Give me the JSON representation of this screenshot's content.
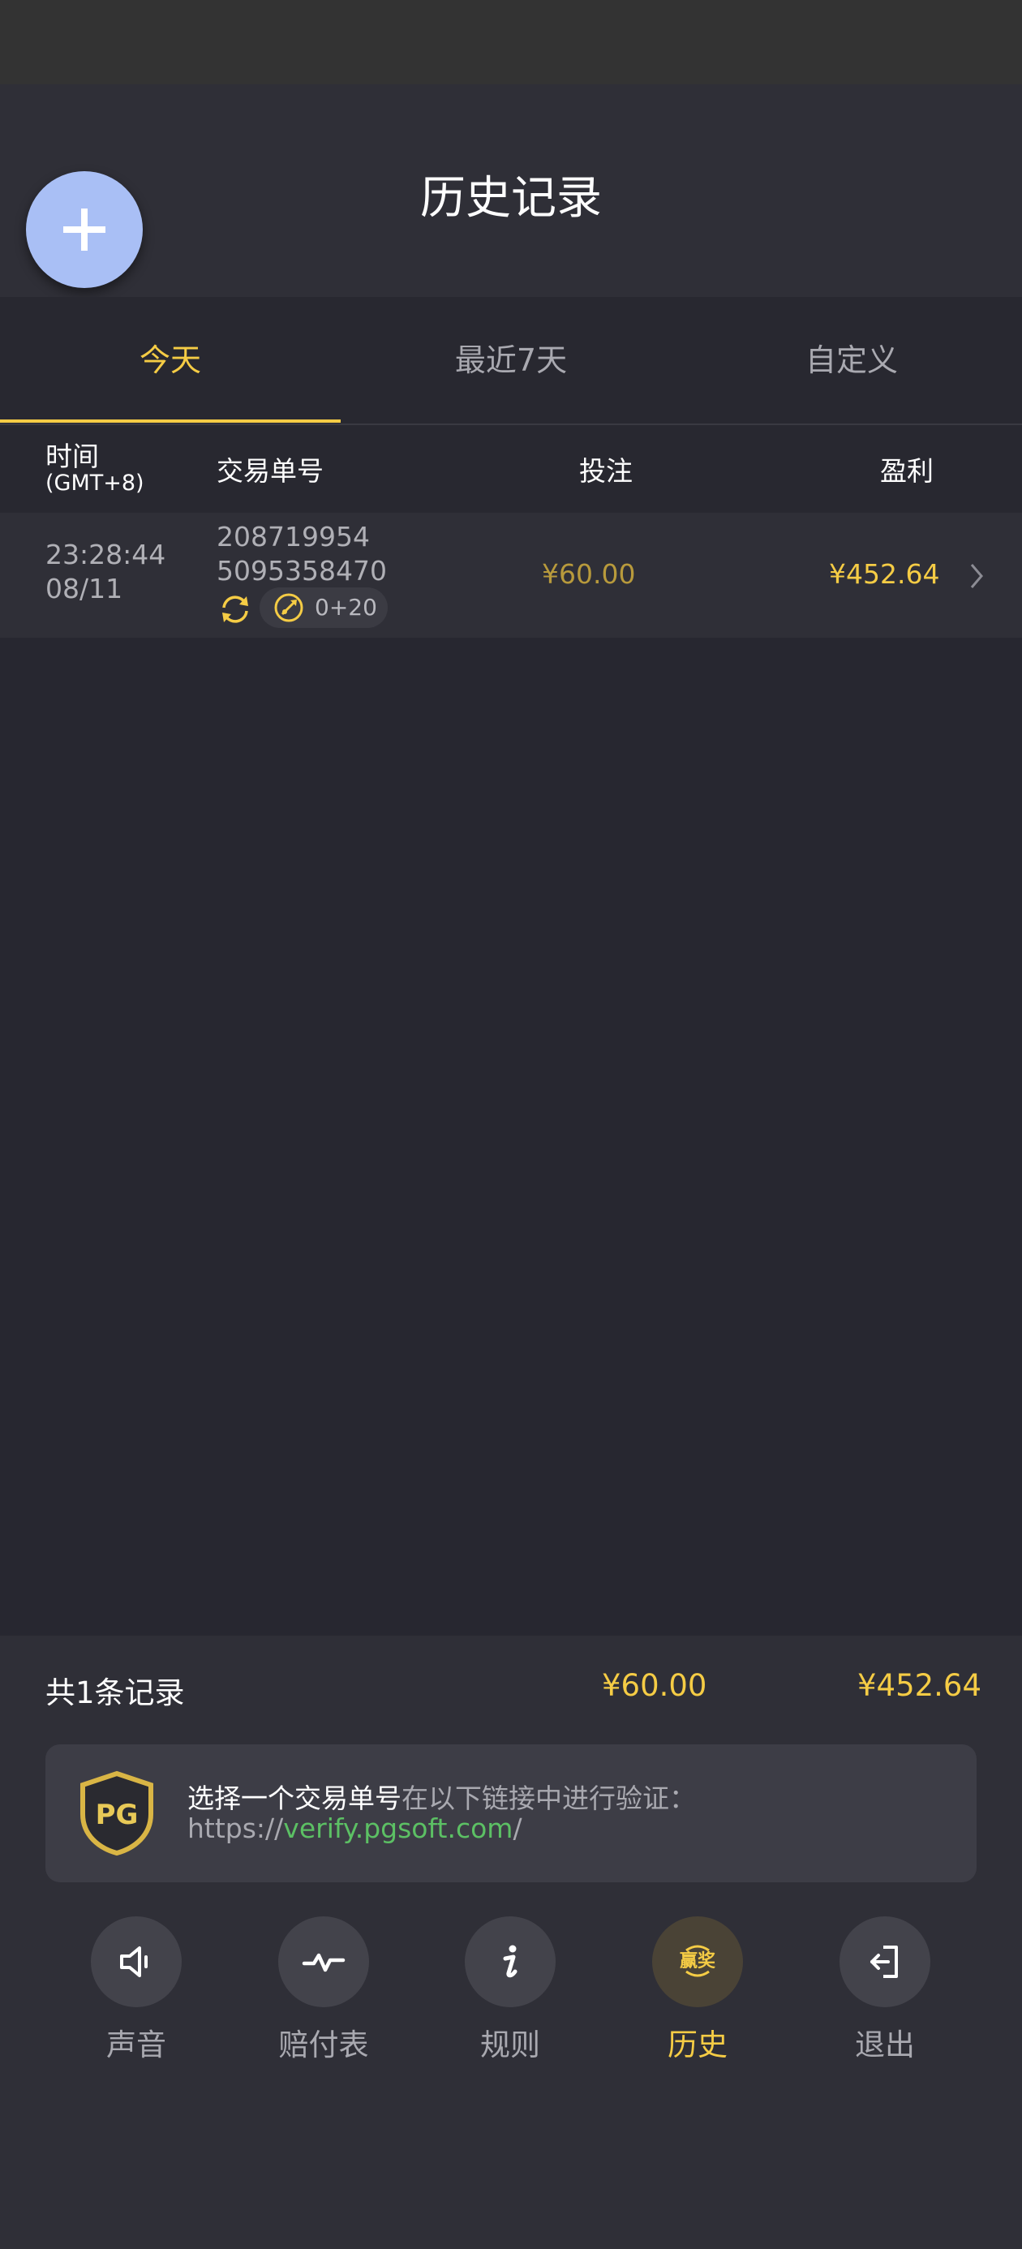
{
  "header": {
    "title": "历史记录"
  },
  "tabs": [
    {
      "label": "今天",
      "active": true
    },
    {
      "label": "最近7天",
      "active": false
    },
    {
      "label": "自定义",
      "active": false
    }
  ],
  "table": {
    "columns": {
      "time": "时间",
      "time_zone": "(GMT+8)",
      "order": "交易单号",
      "bet": "投注",
      "profit": "盈利"
    },
    "rows": [
      {
        "time": "23:28:44",
        "date": "08/11",
        "order_line1": "208719954",
        "order_line2": "5095358470",
        "spins": "0+20",
        "bet": "¥60.00",
        "profit": "¥452.64"
      }
    ]
  },
  "summary": {
    "count_label": "共1条记录",
    "total_bet": "¥60.00",
    "total_profit": "¥452.64"
  },
  "verify": {
    "strong": "选择一个交易单号",
    "rest": "在以下链接中进行验证：",
    "url_prefix": "https://",
    "url_domain": "verify.pgsoft.com",
    "url_suffix": "/",
    "logo_text": "PG"
  },
  "nav": [
    {
      "label": "声音",
      "icon": "speaker-icon",
      "active": false
    },
    {
      "label": "赔付表",
      "icon": "pulse-icon",
      "active": false
    },
    {
      "label": "规则",
      "icon": "info-icon",
      "active": false
    },
    {
      "label": "历史",
      "icon": "win-icon",
      "icon_text": "赢奖",
      "active": true
    },
    {
      "label": "退出",
      "icon": "exit-icon",
      "active": false
    }
  ],
  "colors": {
    "accent": "#f5cc45",
    "link": "#5cc064",
    "fab": "#a9bff5"
  }
}
